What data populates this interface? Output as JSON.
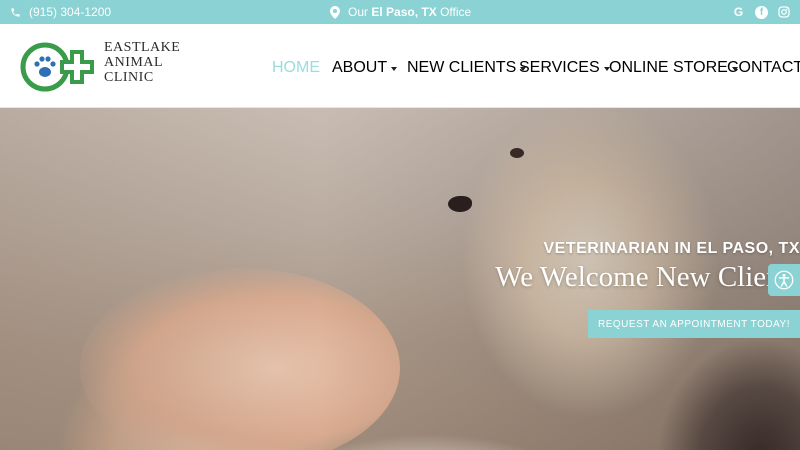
{
  "topbar": {
    "phone": "(915) 304-1200",
    "office_prefix": "Our",
    "office_location": "El Paso, TX",
    "office_suffix": "Office",
    "social": {
      "google": "G",
      "facebook": "f"
    }
  },
  "brand": {
    "line1": "EASTLAKE",
    "line2": "ANIMAL",
    "line3": "CLINIC",
    "colors": {
      "green": "#3a9b4a",
      "blue": "#2f6fb6",
      "teal": "#8ad2d3"
    }
  },
  "nav": {
    "items": [
      {
        "label": "HOME",
        "active": true
      },
      {
        "label": "ABOUT",
        "dropdown": true
      },
      {
        "label": "NEW CLIENTS",
        "dropdown": true
      },
      {
        "label": "SERVICES",
        "dropdown": true
      },
      {
        "label": "ONLINE STORE",
        "dropdown": true
      },
      {
        "label": "CONTACT"
      }
    ]
  },
  "hero": {
    "subtitle": "VETERINARIAN IN EL PASO, TX",
    "title": "We Welcome New Clients",
    "cta": "REQUEST AN APPOINTMENT TODAY!"
  },
  "icons": {
    "phone": "phone-icon",
    "location": "map-pin-icon",
    "accessibility": "accessibility-icon"
  }
}
